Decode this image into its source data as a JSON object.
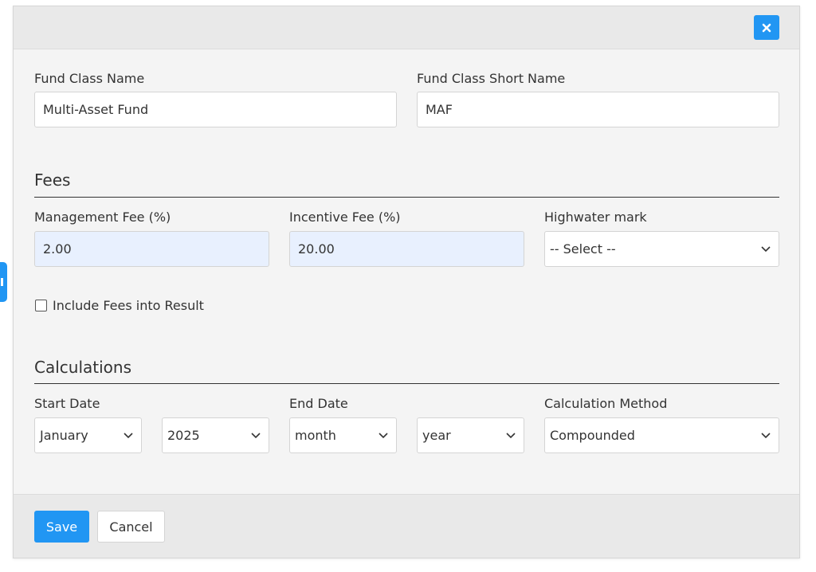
{
  "colors": {
    "accent": "#2196f3",
    "modal_bg": "#f4f4f4",
    "header_bg": "#e9e9e9",
    "autofill_bg": "#e8f0fe"
  },
  "header": {
    "close_icon": "close-icon"
  },
  "fund_class_name": {
    "label": "Fund Class Name",
    "value": "Multi-Asset Fund"
  },
  "fund_class_short_name": {
    "label": "Fund Class Short Name",
    "value": "MAF"
  },
  "fees": {
    "title": "Fees",
    "management_fee": {
      "label": "Management Fee (%)",
      "value": "2.00"
    },
    "incentive_fee": {
      "label": "Incentive Fee (%)",
      "value": "20.00"
    },
    "highwater_mark": {
      "label": "Highwater mark",
      "selected": "-- Select --"
    },
    "include_fees": {
      "label": "Include Fees into Result",
      "checked": false
    }
  },
  "calculations": {
    "title": "Calculations",
    "start_date": {
      "label": "Start Date",
      "month": "January",
      "year": "2025"
    },
    "end_date": {
      "label": "End Date",
      "month": "month",
      "year": "year"
    },
    "calculation_method": {
      "label": "Calculation Method",
      "selected": "Compounded"
    }
  },
  "footer": {
    "save_label": "Save",
    "cancel_label": "Cancel"
  }
}
